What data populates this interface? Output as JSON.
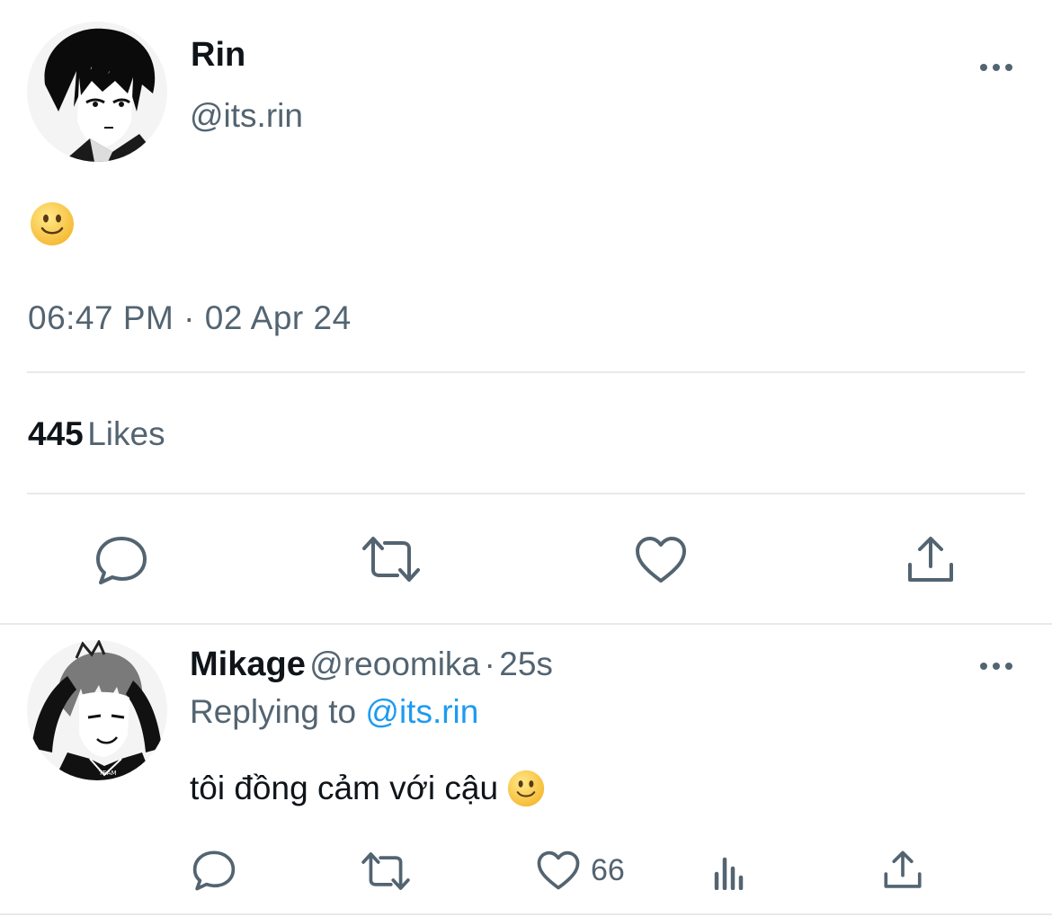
{
  "tweet": {
    "author_name": "Rin",
    "author_handle": "@its.rin",
    "content_emoji": "slightly-smiling-face",
    "timestamp": "06:47 PM · 02 Apr 24",
    "likes_count": "445",
    "likes_label": "Likes",
    "actions": [
      "reply-icon",
      "retweet-icon",
      "like-icon",
      "share-icon"
    ]
  },
  "reply": {
    "author_name": "Mikage",
    "author_handle": "@reoomika",
    "separator": "·",
    "time_ago": "25s",
    "replying_prefix": "Replying to",
    "replying_to": "@its.rin",
    "text": "tôi đồng cảm với cậu",
    "text_emoji": "slightly-smiling-face",
    "like_count": "66",
    "actions": [
      "reply-icon",
      "retweet-icon",
      "like-icon",
      "views-icon",
      "share-icon"
    ]
  },
  "colors": {
    "text_primary": "#0f1419",
    "text_secondary": "#536471",
    "link": "#1d9bf0",
    "divider": "#e7e9eb"
  }
}
